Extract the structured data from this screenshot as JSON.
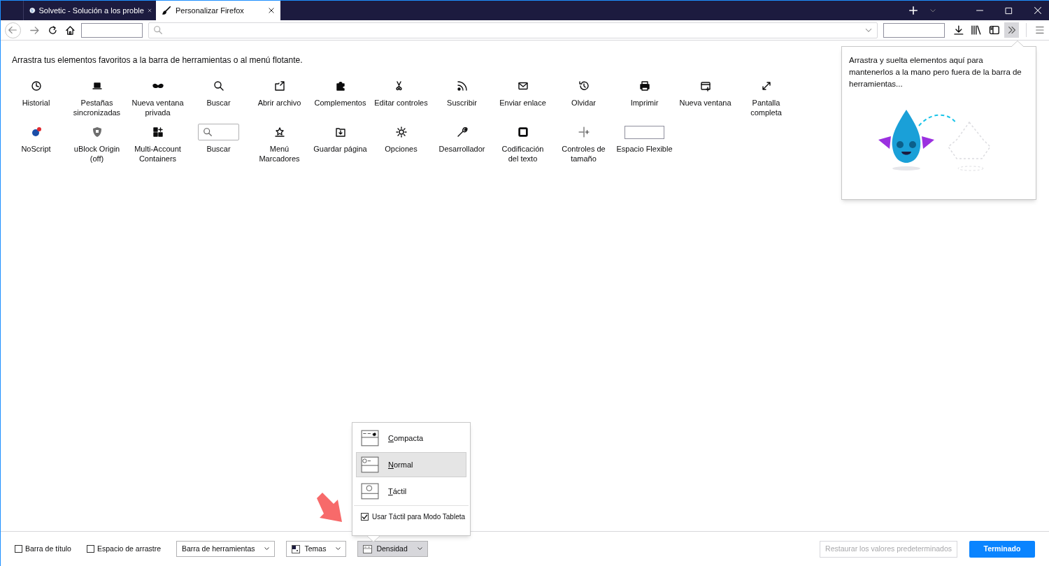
{
  "tabs": [
    {
      "title": "Solvetic - Solución a los proble",
      "selected": false
    },
    {
      "title": "Personalizar Firefox",
      "selected": true
    }
  ],
  "instructions": "Arrastra tus elementos favoritos a la barra de herramientas o al menú flotante.",
  "palette": [
    {
      "kind": "button",
      "label": "Historial"
    },
    {
      "kind": "button",
      "label": "Pestañas\nsincronizadas"
    },
    {
      "kind": "button",
      "label": "Nueva ventana\nprivada"
    },
    {
      "kind": "button",
      "label": "Buscar"
    },
    {
      "kind": "button",
      "label": "Abrir archivo"
    },
    {
      "kind": "button",
      "label": "Complementos"
    },
    {
      "kind": "button",
      "label": "Editar controles"
    },
    {
      "kind": "button",
      "label": "Suscribir"
    },
    {
      "kind": "button",
      "label": "Enviar enlace"
    },
    {
      "kind": "button",
      "label": "Olvidar"
    },
    {
      "kind": "button",
      "label": "Imprimir"
    },
    {
      "kind": "button",
      "label": "Nueva ventana"
    },
    {
      "kind": "button",
      "label": "Pantalla\ncompleta"
    },
    {
      "kind": "button",
      "label": "NoScript"
    },
    {
      "kind": "button",
      "label": "uBlock Origin\n(off)"
    },
    {
      "kind": "button",
      "label": "Multi-Account\nContainers"
    },
    {
      "kind": "search",
      "label": "Buscar"
    },
    {
      "kind": "button",
      "label": "Menú\nMarcadores"
    },
    {
      "kind": "button",
      "label": "Guardar página"
    },
    {
      "kind": "button",
      "label": "Opciones"
    },
    {
      "kind": "button",
      "label": "Desarrollador"
    },
    {
      "kind": "button",
      "label": "Codificación\ndel texto"
    },
    {
      "kind": "zoom",
      "label": "Controles de\ntamaño"
    },
    {
      "kind": "spacer",
      "label": "Espacio Flexible"
    }
  ],
  "overflow_panel": {
    "text": "Arrastra y suelta elementos aquí para mantenerlos a la mano pero fuera de la barra de herramientas..."
  },
  "density_menu": {
    "items": [
      {
        "label": "Compacta",
        "selected": false
      },
      {
        "label": "Normal",
        "selected": true
      },
      {
        "label": "Táctil",
        "selected": false
      }
    ],
    "tablet_option": {
      "label": "Usar Táctil para Modo Tableta",
      "checked": true
    }
  },
  "bottom_bar": {
    "checkboxes": [
      {
        "label": "Barra de título",
        "checked": false
      },
      {
        "label": "Espacio de arrastre",
        "checked": false
      }
    ],
    "dropdowns": [
      {
        "label": "Barra de herramientas",
        "pressed": false
      },
      {
        "label": "Temas",
        "pressed": false
      },
      {
        "label": "Densidad",
        "pressed": true
      }
    ],
    "restore_button": {
      "label": "Restaurar los valores predeterminados",
      "disabled": true
    },
    "done_button": {
      "label": "Terminado"
    }
  }
}
